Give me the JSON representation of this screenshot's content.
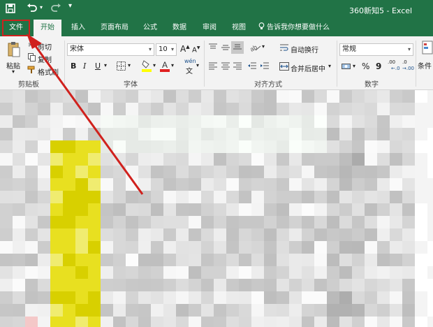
{
  "title_bar": {
    "document_title": "360新知5  -  Excel",
    "save_icon": "save-icon",
    "undo_icon": "undo-icon",
    "redo_icon": "redo-icon",
    "customize_icon": "customize-qat-icon"
  },
  "tabs": [
    {
      "label": "文件"
    },
    {
      "label": "开始"
    },
    {
      "label": "插入"
    },
    {
      "label": "页面布局"
    },
    {
      "label": "公式"
    },
    {
      "label": "数据"
    },
    {
      "label": "审阅"
    },
    {
      "label": "视图"
    }
  ],
  "tell_me": {
    "text": "告诉我你想要做什么",
    "icon": "lightbulb-icon"
  },
  "clipboard": {
    "paste": "粘贴",
    "cut": "剪切",
    "copy": "复制",
    "format_painter": "格式刷",
    "group_label": "剪贴板"
  },
  "font": {
    "name": "宋体",
    "size": "10",
    "grow": "A",
    "shrink": "A",
    "bold": "B",
    "italic": "I",
    "underline": "U",
    "phonetic": "wén",
    "group_label": "字体"
  },
  "alignment": {
    "wrap_text": "自动换行",
    "merge_center": "合并后居中",
    "group_label": "对齐方式"
  },
  "number": {
    "format": "常规",
    "percent": "%",
    "comma": "9",
    "inc_decimal": ".00",
    "dec_decimal": ".0",
    "group_label": "数字"
  },
  "styles": {
    "conditional": "条件"
  },
  "colors": {
    "excel_green": "#217346",
    "highlight_box": "#d0211d",
    "arrow": "#d0211d",
    "highlight_yellow": "#ffff00",
    "font_red": "#e02020"
  }
}
